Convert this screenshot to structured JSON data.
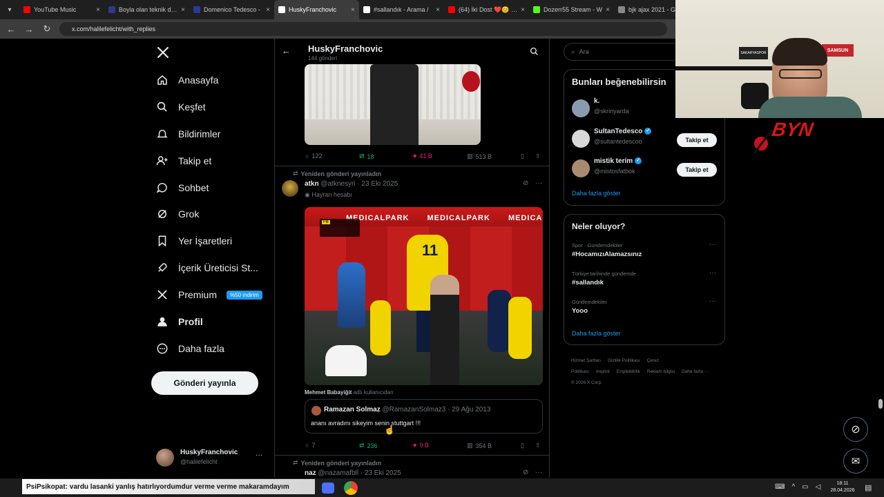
{
  "browser": {
    "tabs": [
      {
        "title": "YouTube Music",
        "color": "#ff0000",
        "active": false
      },
      {
        "title": "Boyla olan teknik dire",
        "color": "#2b3a8c",
        "active": false
      },
      {
        "title": "Domenico Tedesco -",
        "color": "#2b3a8c",
        "active": false
      },
      {
        "title": "HuskyFranchovic",
        "color": "#ffffff",
        "active": true
      },
      {
        "title": "#sallandık - Arama / ",
        "color": "#ffffff",
        "active": false
      },
      {
        "title": "(64) İki Dost ❤️😊 #h",
        "color": "#ff0000",
        "active": false
      },
      {
        "title": "Dozerr55 Stream - W",
        "color": "#53fc18",
        "active": false
      },
      {
        "title": "bjk ajax 2021 - Goo",
        "color": "#888888",
        "active": false
      }
    ],
    "url": "x.com/halilefelicht/with_replies"
  },
  "nav": {
    "items": [
      {
        "label": "Anasayfa",
        "icon": "home-icon"
      },
      {
        "label": "Keşfet",
        "icon": "search-icon"
      },
      {
        "label": "Bildirimler",
        "icon": "bell-icon"
      },
      {
        "label": "Takip et",
        "icon": "follow-icon"
      },
      {
        "label": "Sohbet",
        "icon": "chat-icon"
      },
      {
        "label": "Grok",
        "icon": "grok-icon"
      },
      {
        "label": "Yer İşaretleri",
        "icon": "bookmark-icon"
      },
      {
        "label": "İçerik Üreticisi St...",
        "icon": "rocket-icon"
      },
      {
        "label": "Premium",
        "icon": "x-icon",
        "badge": "%50 indirim"
      },
      {
        "label": "Profil",
        "icon": "person-icon"
      },
      {
        "label": "Daha fazla",
        "icon": "more-circle-icon"
      }
    ],
    "post_button": "Gönderi yayınla",
    "account": {
      "name": "HuskyFranchovic",
      "handle": "@halilefelicht",
      "more": "···"
    }
  },
  "header": {
    "title": "HuskyFranchovic",
    "subtitle": "144 gönderi"
  },
  "post1": {
    "actions": {
      "replies": "122",
      "reposts": "18",
      "likes": "41 B",
      "views": "513 B"
    }
  },
  "post2": {
    "repost_label": "Yeniden gönderi yayınladın",
    "author": "atkn",
    "handle": "@atknesyri",
    "date": "23 Eki 2025",
    "bio_badge": "Hayran hesabı",
    "video": {
      "ad_board": "MEDICALPARK",
      "score_tag": "FB",
      "player_number": "11"
    },
    "from_user_bold": "Mehmet Babayiğit",
    "from_user_rest": "adlı kullanıcıdan",
    "quote": {
      "name": "Ramazan Solmaz",
      "handle": "@RamazanSolmaz3",
      "date": "29 Ağu 2013",
      "text": "ananı avradını sikeyim senin stuttgart !!!"
    },
    "actions": {
      "replies": "7",
      "reposts": "236",
      "likes": "9 B",
      "views": "354 B"
    }
  },
  "post3": {
    "repost_label": "Yeniden gönderi yayınladın",
    "author": "naz",
    "handle": "@nazamafbll",
    "date": "23 Eki 2025"
  },
  "sidebar": {
    "search_placeholder": "Ara",
    "suggest_title": "Bunları beğenebilirsin",
    "suggestions": [
      {
        "name": "k.",
        "handle": "@skrinyarda",
        "verified": false,
        "button": ""
      },
      {
        "name": "SultanTedesco",
        "handle": "@sultantedescoo",
        "verified": true,
        "button": "Takip et"
      },
      {
        "name": "mistik terim",
        "handle": "@mistosfatbok",
        "verified": true,
        "button": "Takip et"
      }
    ],
    "show_more": "Daha fazla göster",
    "trends_title": "Neler oluyor?",
    "trends": [
      {
        "context": "Spor · Gündemdekiler",
        "name": "#HocamızıAlamazsınız"
      },
      {
        "context": "Türkiye tarihinde gündemde",
        "name": "#sallandık"
      },
      {
        "context": "Gündemdekiler",
        "name": "Yooo"
      }
    ],
    "trends_more": "Daha fazla göster",
    "footer_links": [
      "Hizmet Şartları",
      "Gizlilik Politikası",
      "Çerez Politikası",
      "Imprint",
      "Erişilebilirlik",
      "Reklam bilgisi",
      "Daha fazla ···"
    ],
    "copyright": "© 2026 X Corp."
  },
  "webcam": {
    "sign1": "SAMSUN",
    "sign2": "SAKARYASPOR"
  },
  "stream_logo": "BYN",
  "ticker": "PsiPsikopat: vardu lasanki yanlış hatırlıyordumdur verme verme makaramdayım",
  "clock": {
    "time": "18:11",
    "date": "28.04.2026"
  },
  "colors": {
    "accent": "#1d9bf0",
    "like": "#f91880",
    "repost": "#00ba7c"
  }
}
